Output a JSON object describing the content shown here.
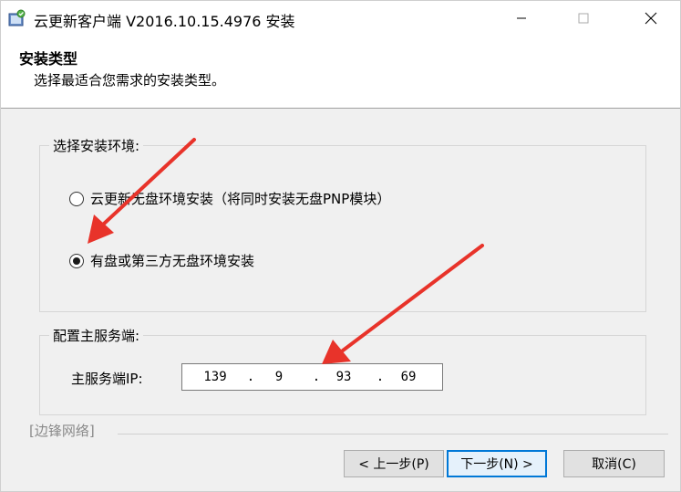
{
  "window": {
    "title": "云更新客户端 V2016.10.15.4976 安装"
  },
  "header": {
    "title": "安装类型",
    "subtitle": "选择最适合您需求的安装类型。"
  },
  "env_group": {
    "label": "选择安装环境:",
    "options": [
      {
        "label": "云更新无盘环境安装（将同时安装无盘PNP模块）",
        "selected": false
      },
      {
        "label": "有盘或第三方无盘环境安装",
        "selected": true
      }
    ]
  },
  "server_group": {
    "label": "配置主服务端:",
    "ip_label": "主服务端IP:",
    "ip": [
      "139",
      "9",
      "93",
      "69"
    ]
  },
  "footer": {
    "brand": "[边锋网络]",
    "back_label": "< 上一步(P)",
    "next_label": "下一步(N) >",
    "cancel_label": "取消(C)"
  },
  "colors": {
    "accent": "#0078d7",
    "annotation_arrow": "#e8332a"
  }
}
